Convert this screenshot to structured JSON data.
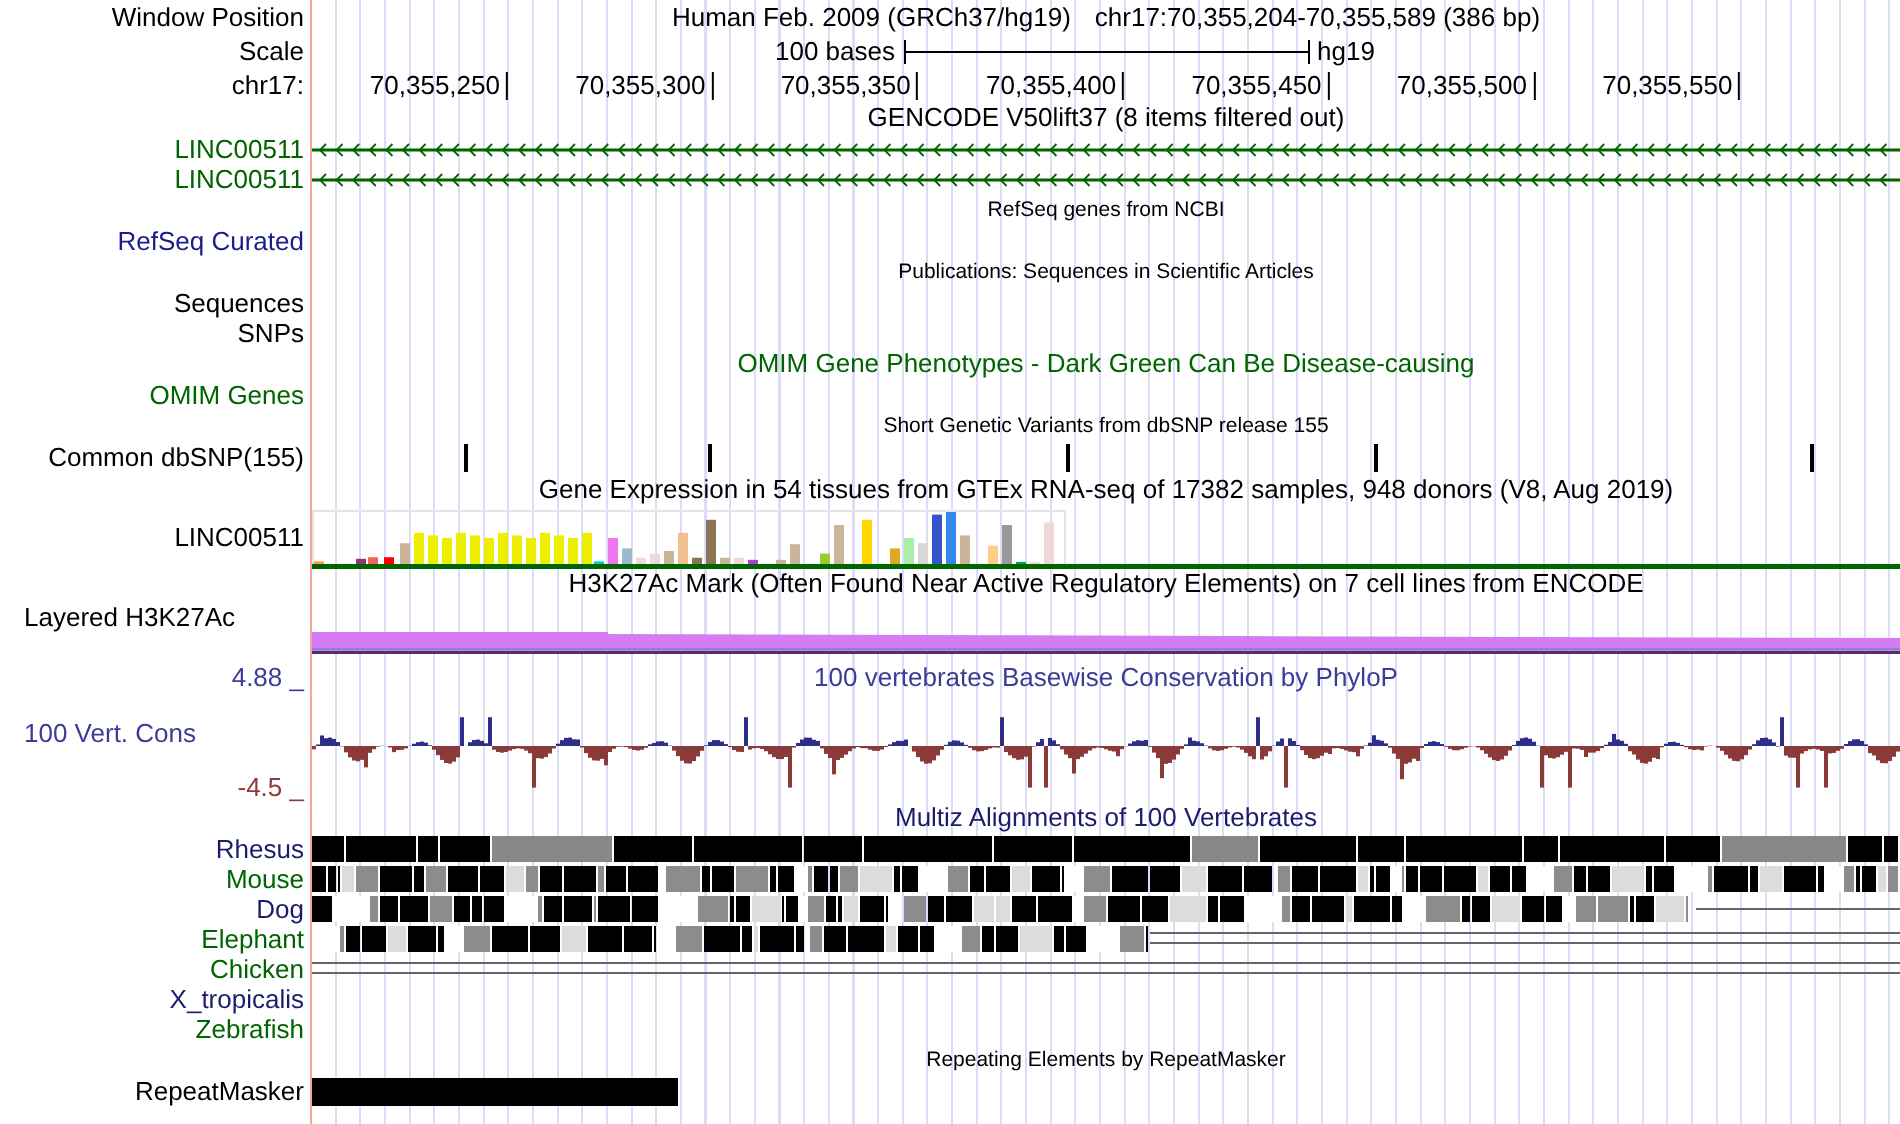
{
  "header": {
    "label": "Window Position",
    "assembly": "Human Feb. 2009 (GRCh37/hg19)",
    "position": "chr17:70,355,204-70,355,589 (386 bp)"
  },
  "scale": {
    "label": "Scale",
    "length": "100 bases",
    "genome": "hg19"
  },
  "ruler": {
    "label": "chr17:",
    "ticks": [
      "70,355,250",
      "70,355,300",
      "70,355,350",
      "70,355,400",
      "70,355,450",
      "70,355,500",
      "70,355,550"
    ]
  },
  "tracks": [
    {
      "kind": "title",
      "text": "GENCODE V50lift37 (8 items filtered out)",
      "color": "#000000"
    },
    {
      "kind": "gene",
      "label": "LINC00511",
      "color": "#006400"
    },
    {
      "kind": "gene",
      "label": "LINC00511",
      "color": "#006400"
    },
    {
      "kind": "caption",
      "text": "RefSeq genes from NCBI",
      "color": "#000000"
    },
    {
      "kind": "label",
      "label": "RefSeq Curated",
      "color": "#1c1c8c"
    },
    {
      "kind": "caption",
      "text": "Publications: Sequences in Scientific Articles",
      "color": "#000000"
    },
    {
      "kind": "label",
      "label": "Sequences",
      "color": "#000000"
    },
    {
      "kind": "label",
      "label": "SNPs",
      "color": "#000000"
    },
    {
      "kind": "title",
      "text": "OMIM Gene Phenotypes - Dark Green Can Be Disease-causing",
      "color": "#006400"
    },
    {
      "kind": "label",
      "label": "OMIM Genes",
      "color": "#006400"
    },
    {
      "kind": "caption",
      "text": "Short Genetic Variants from dbSNP release 155",
      "color": "#000000"
    },
    {
      "kind": "snp",
      "label": "Common dbSNP(155)",
      "color": "#000000"
    },
    {
      "kind": "title",
      "text": "Gene Expression in 54 tissues from GTEx RNA-seq of 17382 samples, 948 donors (V8, Aug 2019)",
      "color": "#000000"
    },
    {
      "kind": "expression",
      "label": "LINC00511",
      "color": "#000000"
    },
    {
      "kind": "layered",
      "label": "Layered H3K27Ac",
      "title": "H3K27Ac Mark (Often Found Near Active Regulatory Elements) on 7 cell lines from ENCODE",
      "color": "#000000"
    },
    {
      "kind": "conservation",
      "label": "100 Vert. Cons",
      "title": "100 vertebrates Basewise Conservation by PhyloP",
      "max": "4.88 _",
      "min": "-4.5 _",
      "color": "#3c3c96"
    },
    {
      "kind": "title",
      "text": "Multiz Alignments of 100 Vertebrates",
      "color": "#1c1c6c"
    },
    {
      "kind": "alignment",
      "label": "Rhesus",
      "color": "#1c1c6c"
    },
    {
      "kind": "alignment",
      "label": "Mouse",
      "color": "#006400"
    },
    {
      "kind": "alignment",
      "label": "Dog",
      "color": "#1c1c6c"
    },
    {
      "kind": "alignment",
      "label": "Elephant",
      "color": "#006400"
    },
    {
      "kind": "alignment",
      "label": "Chicken",
      "color": "#006400"
    },
    {
      "kind": "alignment",
      "label": "X_tropicalis",
      "color": "#1c1c6c"
    },
    {
      "kind": "alignment",
      "label": "Zebrafish",
      "color": "#006400"
    },
    {
      "kind": "caption",
      "text": "Repeating Elements by RepeatMasker",
      "color": "#000000"
    },
    {
      "kind": "repeat",
      "label": "RepeatMasker",
      "color": "#000000"
    }
  ]
}
